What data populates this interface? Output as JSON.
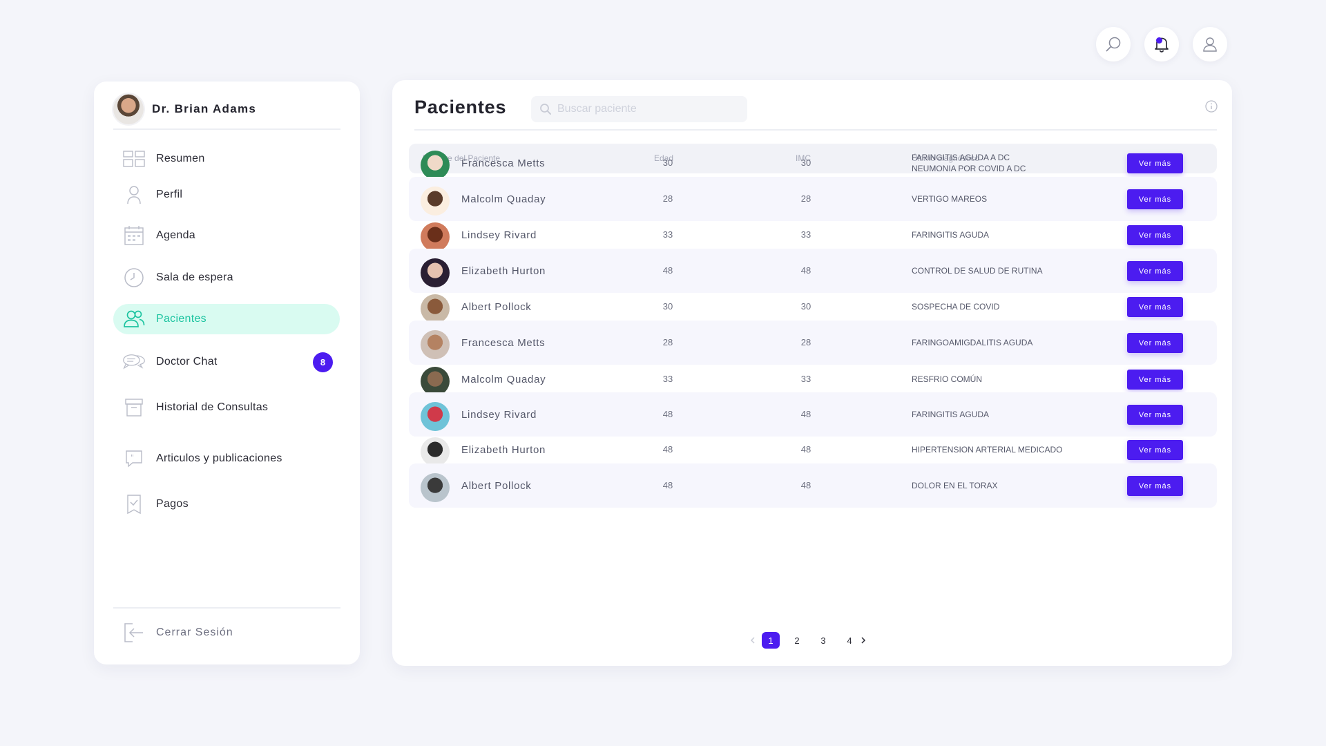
{
  "doctor": {
    "name": "Dr. Brian Adams"
  },
  "sidebar": {
    "items": [
      {
        "label": "Resumen",
        "icon": "dashboard-grid-icon"
      },
      {
        "label": "Perfil",
        "icon": "user-icon"
      },
      {
        "label": "Agenda",
        "icon": "calendar-icon"
      },
      {
        "label": "Sala de espera",
        "icon": "clock-icon"
      },
      {
        "label": "Pacientes",
        "icon": "users-icon",
        "active": true
      },
      {
        "label": "Doctor Chat",
        "icon": "chat-bubbles-icon",
        "badge": "8"
      },
      {
        "label": "Historial de Consultas",
        "icon": "archive-box-icon"
      },
      {
        "label": "Articulos y publicaciones",
        "icon": "quote-icon"
      },
      {
        "label": "Pagos",
        "icon": "receipt-check-icon"
      }
    ],
    "logout_label": "Cerrar Sesión"
  },
  "main": {
    "title": "Pacientes",
    "search_placeholder": "Buscar paciente",
    "columns": [
      "Nombre del Paciente",
      "Edad",
      "IMC",
      "Último diagnóstico"
    ],
    "button_label": "Ver más",
    "rows": [
      {
        "name": "Francesca Metts",
        "age": "30",
        "imc": "30",
        "diag": [
          "FARINGITIS AGUDA A DC",
          "NEUMONIA POR COVID A DC"
        ]
      },
      {
        "name": "Malcolm Quaday",
        "age": "28",
        "imc": "28",
        "diag": [
          "VERTIGO MAREOS"
        ]
      },
      {
        "name": "Lindsey Rivard",
        "age": "33",
        "imc": "33",
        "diag": [
          "FARINGITIS AGUDA"
        ]
      },
      {
        "name": "Elizabeth Hurton",
        "age": "48",
        "imc": "48",
        "diag": [
          "CONTROL DE SALUD DE RUTINA"
        ]
      },
      {
        "name": "Albert Pollock",
        "age": "30",
        "imc": "30",
        "diag": [
          "SOSPECHA DE COVID"
        ]
      },
      {
        "name": "Francesca Metts",
        "age": "28",
        "imc": "28",
        "diag": [
          "FARINGOAMIGDALITIS AGUDA"
        ]
      },
      {
        "name": "Malcolm Quaday",
        "age": "33",
        "imc": "33",
        "diag": [
          "RESFRIO COMÚN"
        ]
      },
      {
        "name": "Lindsey Rivard",
        "age": "48",
        "imc": "48",
        "diag": [
          "FARINGITIS AGUDA"
        ]
      },
      {
        "name": "Elizabeth Hurton",
        "age": "48",
        "imc": "48",
        "diag": [
          "HIPERTENSION ARTERIAL MEDICADO"
        ]
      },
      {
        "name": "Albert Pollock",
        "age": "48",
        "imc": "48",
        "diag": [
          "DOLOR EN EL TORAX"
        ]
      }
    ],
    "pagination": {
      "pages": [
        "1",
        "2",
        "3",
        "4"
      ],
      "current": "1"
    }
  },
  "colors": {
    "accent": "#4c1cf0",
    "active_green": "#1cc4a0",
    "active_bg": "#d9fbf1",
    "row_alt": "#f6f6fd"
  },
  "top_icons": [
    "search-icon",
    "bell-icon",
    "user-icon"
  ]
}
